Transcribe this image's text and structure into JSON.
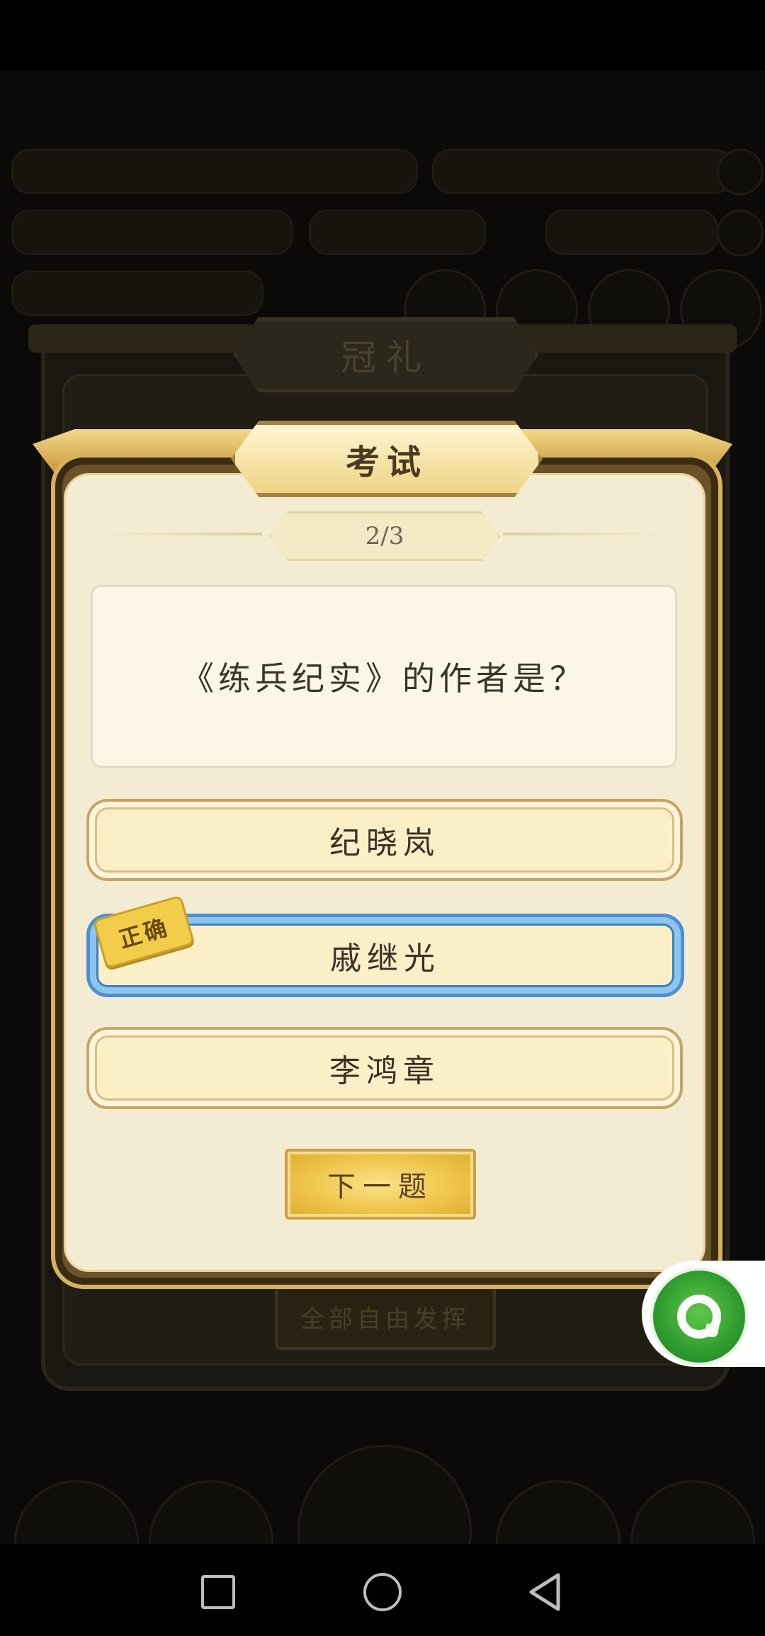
{
  "background": {
    "back_dialog_title": "冠礼",
    "back_dialog_button": "全部自由发挥"
  },
  "dialog": {
    "title": "考试",
    "progress": "2/3",
    "question": "《练兵纪实》的作者是？",
    "options": [
      {
        "label": "纪晓岚",
        "state": "normal"
      },
      {
        "label": "戚继光",
        "state": "correct"
      },
      {
        "label": "李鸿章",
        "state": "normal"
      }
    ],
    "correct_tag": "正确",
    "next_button": "下一题"
  },
  "colors": {
    "panel": "#f4ecd2",
    "gold": "#efc64b",
    "correct_blue": "#8cc6f0"
  },
  "floating_button": {
    "icon": "assistant-bubble-icon"
  },
  "navbar": {
    "recent_icon": "square-recent-icon",
    "home_icon": "circle-home-icon",
    "back_icon": "triangle-back-icon"
  }
}
